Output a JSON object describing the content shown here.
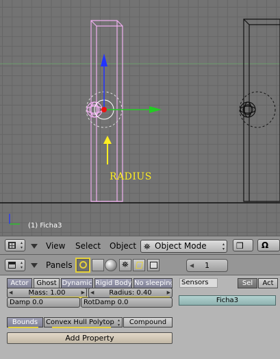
{
  "viewport": {
    "object_label": "(1) Ficha3",
    "annotation": "RADIUS"
  },
  "header": {
    "view_menu": "View",
    "select_menu": "Select",
    "object_menu": "Object",
    "mode": "Object Mode"
  },
  "buttons_header": {
    "panels_label": "Panels",
    "frame": "1"
  },
  "physics": {
    "actor": "Actor",
    "ghost": "Ghost",
    "dynamic": "Dynamic",
    "rigid_body": "Rigid Body",
    "no_sleeping": "No sleeping",
    "mass": "Mass: 1.00",
    "radius": "Radius: 0.40",
    "damp": "Damp 0.0",
    "rotdamp": "RotDamp 0.0",
    "bounds": "Bounds",
    "bounds_type": "Convex Hull Polytop",
    "compound": "Compound",
    "add_property": "Add Property"
  },
  "logic": {
    "sensors": "Sensors",
    "sel": "Sel",
    "act": "Act",
    "object_name": "Ficha3"
  },
  "colors": {
    "highlight": "#e6d23c",
    "selected_outline": "#f0b0f0",
    "axis_z": "#2233ff",
    "axis_x": "#22cc22"
  }
}
